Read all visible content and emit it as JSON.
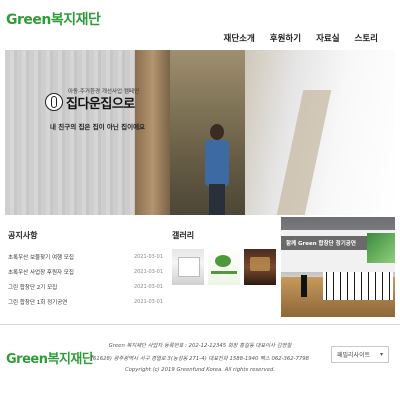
{
  "header": {
    "logo_en": "Green",
    "logo_kr": "복지재단",
    "nav": [
      "재단소개",
      "후원하기",
      "자료실",
      "스토리"
    ]
  },
  "hero": {
    "subtitle": "아동·주거환경 개선사업 캠페인",
    "title": "집다운집으로",
    "caption": "내 친구의 집은 집이 아닌 집이에요"
  },
  "notice": {
    "title": "공지사항",
    "items": [
      {
        "title": "초록우산 보물찾기 여행 모집",
        "date": "2021-03-01"
      },
      {
        "title": "초록우산 사업장 후원자 모집",
        "date": "2021-03-01"
      },
      {
        "title": "그린 합창단 2기 모집",
        "date": "2021-03-01"
      },
      {
        "title": "그린 합창단 1회 정기공연",
        "date": "2021-03-01"
      }
    ]
  },
  "gallery": {
    "title": "갤러리"
  },
  "concert": {
    "banner": "함께 Green 합창단 정기공연"
  },
  "footer": {
    "logo_en": "Green",
    "logo_kr": "복지재단",
    "line1": "Green 복지재단 사업자 등록번호 : 202-12-12345 회장 홍길동 대표이사 김영철",
    "line2": "(61628) 광주광역시 서구 경열로 3(농성동 271-4) 대표전화 1588-1940 팩스 062-362-7798",
    "line3": "Copyright (c) 2019 Greenfund Korea. All rights reserved.",
    "family_select": "패밀리사이트"
  }
}
